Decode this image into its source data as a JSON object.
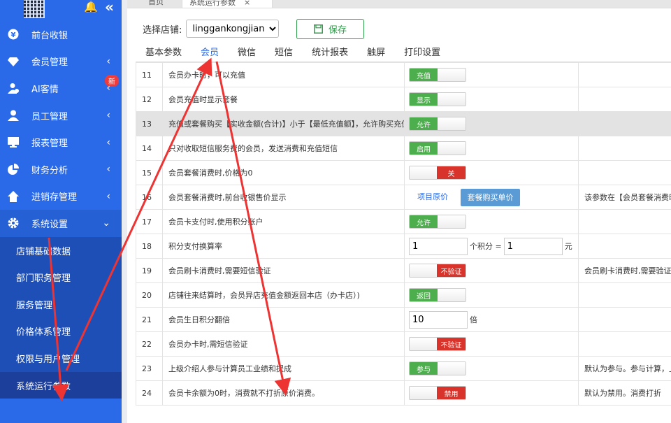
{
  "sidebar": {
    "items": [
      {
        "label": "前台收银",
        "icon": "yen-icon",
        "chev": ""
      },
      {
        "label": "会员管理",
        "icon": "diamond-icon",
        "chev": "‹"
      },
      {
        "label": "AI客情",
        "icon": "user-check-icon",
        "chev": "‹",
        "badge": "新"
      },
      {
        "label": "员工管理",
        "icon": "user-icon",
        "chev": "‹"
      },
      {
        "label": "报表管理",
        "icon": "monitor-icon",
        "chev": "‹"
      },
      {
        "label": "财务分析",
        "icon": "pie-chart-icon",
        "chev": "‹"
      },
      {
        "label": "进销存管理",
        "icon": "home-icon",
        "chev": "‹"
      },
      {
        "label": "系统设置",
        "icon": "gear-icon",
        "chev": "⌄"
      }
    ],
    "submenu": [
      "店铺基础数据",
      "部门职务管理",
      "服务管理",
      "价格体系管理",
      "权限与用户管理",
      "系统运行参数"
    ]
  },
  "tabs": {
    "home": "首页",
    "current": "系统运行参数",
    "close": "×"
  },
  "shop": {
    "label": "选择店铺:",
    "value": "linggankongjian"
  },
  "save_label": "保存",
  "subtabs": [
    "基本参数",
    "会员",
    "微信",
    "短信",
    "统计报表",
    "触屏",
    "打印设置"
  ],
  "rows": [
    {
      "num": "11",
      "name": "会员办卡时，可以充值",
      "on": "充值"
    },
    {
      "num": "12",
      "name": "会员充值时显示套餐",
      "on": "显示"
    },
    {
      "num": "13",
      "name": "充值或套餐购买【实收金额(合计)】小于【最低充值额】，允许购买充值",
      "on": "允许"
    },
    {
      "num": "14",
      "name": "只对收取短信服务费的会员，发送消费和充值短信",
      "on": "启用"
    },
    {
      "num": "15",
      "name": "会员套餐消费时,价格为0",
      "off": "关"
    },
    {
      "num": "16",
      "name": "会员套餐消费时,前台收银售价显示",
      "opt1": "项目原价",
      "opt2": "套餐购买单价",
      "note": "该参数在【会员套餐消费时"
    },
    {
      "num": "17",
      "name": "会员卡支付时,使用积分账户",
      "on": "允许"
    },
    {
      "num": "18",
      "name": "积分支付换算率",
      "in1": "1",
      "mid": "个积分 =",
      "in2": "1",
      "unit": "元"
    },
    {
      "num": "19",
      "name": "会员刷卡消费时,需要短信验证",
      "off": "不验证",
      "note": "会员刷卡消费时,需要验证会"
    },
    {
      "num": "20",
      "name": "店铺往来结算时，会员异店充值金额返回本店（办卡店）)",
      "on": "返回"
    },
    {
      "num": "21",
      "name": "会员生日积分翻倍",
      "in1": "10",
      "unit": "倍"
    },
    {
      "num": "22",
      "name": "会员办卡时,需短信验证",
      "off": "不验证"
    },
    {
      "num": "23",
      "name": "上级介绍人参与计算员工业绩和提成",
      "on": "参与",
      "note": "默认为参与。参与计算，上"
    },
    {
      "num": "24",
      "name": "会员卡余额为0时，消费就不打折原价消费。",
      "off": "禁用",
      "note": "默认为禁用。消费打折"
    }
  ],
  "colors": {
    "sidebar": "#2a6ae8",
    "on": "#4cae4c",
    "off": "#d9342b",
    "arrow": "#ee3333"
  }
}
